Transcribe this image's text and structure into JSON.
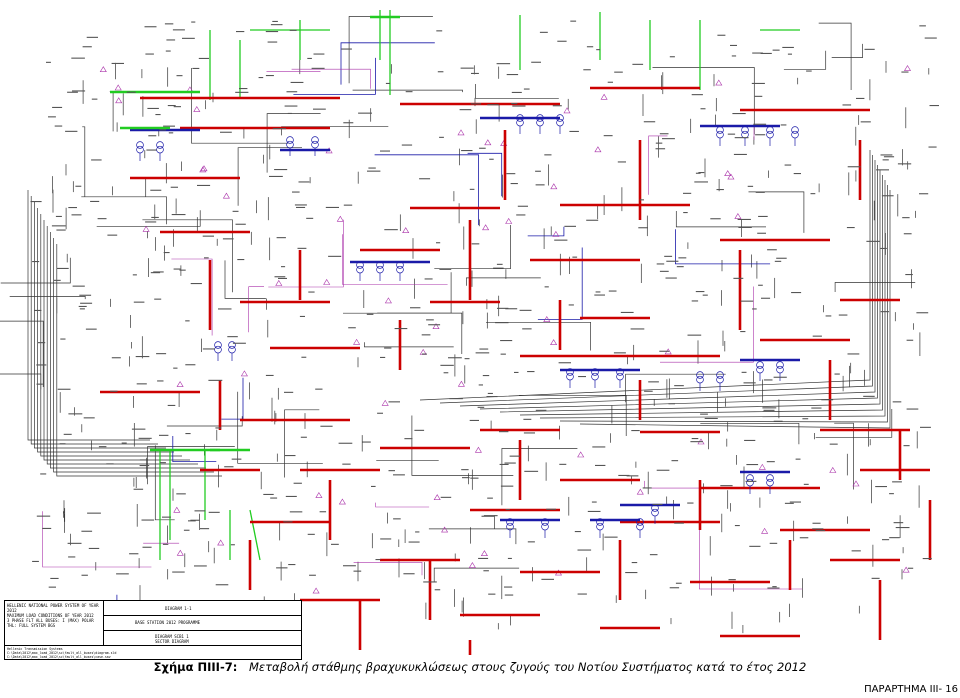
{
  "info_box": {
    "header_lines": [
      "HELLENIC NATIONAL POWER SYSTEM OF YEAR 2012",
      "MAXIMUM LOAD CONDITIONS OF YEAR 2012",
      "3 PHASE FLT ALL BUSES: I (MAX) POLAR",
      "THL: FULL SYSTEM BGS"
    ],
    "row1": "DIAGRAM 1-1",
    "row2": "BASE STATION 2012 PROGRAMME",
    "row3": "DIAGRAM SCB1 1",
    "row3b": "SECTOR DIAGRAM",
    "footer": [
      "Hellenic Transmission Systems",
      "C:\\Data\\2012\\max_load_2012\\sc\\fault_all_buses\\diagram.sld",
      "C:\\Data\\2012\\max_load_2012\\sc\\fault_all_buses\\case.sav"
    ]
  },
  "figure": {
    "label": "Σχήμα ΠΙΙΙ-7:",
    "caption": "Μεταβολή στάθμης βραχυκυκλώσεως στους ζυγούς του Νοτίου Συστήματος κατά το έτος 2012"
  },
  "page_number": "ΠΑΡΑΡΤΗΜΑ ΙΙΙ- 16",
  "colors": {
    "bus_red": "#cc0000",
    "feeder_green": "#22cc22",
    "line_blue": "#1a1aa8",
    "line_black": "#333333",
    "label_purple": "#aa33aa"
  }
}
